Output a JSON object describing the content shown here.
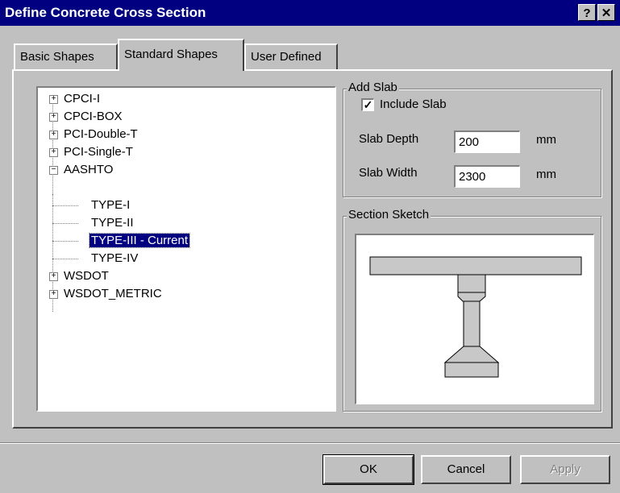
{
  "window": {
    "title": "Define Concrete Cross Section",
    "help_label": "?",
    "close_label": "✕"
  },
  "tabs": [
    {
      "label": "Basic Shapes",
      "active": false
    },
    {
      "label": "Standard Shapes",
      "active": true
    },
    {
      "label": "User Defined",
      "active": false
    }
  ],
  "tree": {
    "nodes": [
      {
        "label": "CPCI-I",
        "expander": "+"
      },
      {
        "label": "CPCI-BOX",
        "expander": "+"
      },
      {
        "label": "PCI-Double-T",
        "expander": "+"
      },
      {
        "label": "PCI-Single-T",
        "expander": "+"
      },
      {
        "label": "AASHTO",
        "expander": "−"
      },
      {
        "label": "TYPE-I"
      },
      {
        "label": "TYPE-II"
      },
      {
        "label": "TYPE-III - Current",
        "selected": true
      },
      {
        "label": "TYPE-IV"
      },
      {
        "label": "WSDOT",
        "expander": "+"
      },
      {
        "label": "WSDOT_METRIC",
        "expander": "+"
      }
    ]
  },
  "add_slab": {
    "group_label": "Add Slab",
    "include_label": "Include Slab",
    "include_checked": "✓",
    "depth_label": "Slab Depth",
    "depth_value": "200",
    "depth_unit": "mm",
    "width_label": "Slab Width",
    "width_value": "2300",
    "width_unit": "mm"
  },
  "sketch": {
    "group_label": "Section Sketch"
  },
  "buttons": {
    "ok": "OK",
    "cancel": "Cancel",
    "apply": "Apply"
  },
  "colors": {
    "titlebar": "#000080",
    "selection": "#000080",
    "face": "#c0c0c0",
    "sketch_fill": "#c8c8c8"
  }
}
